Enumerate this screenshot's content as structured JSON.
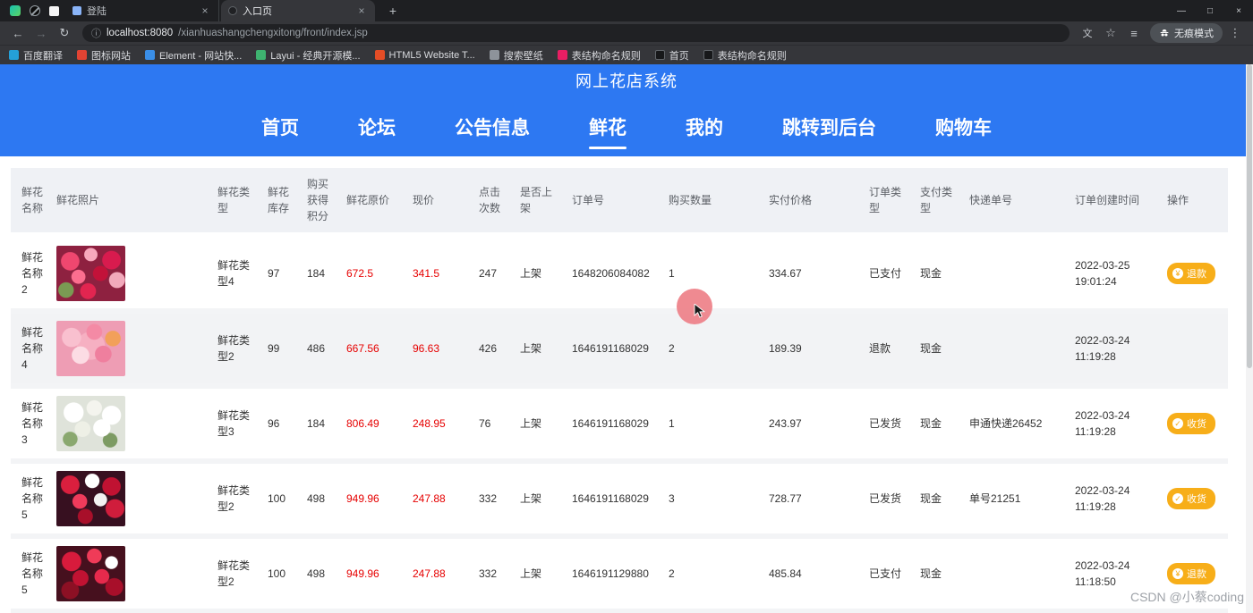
{
  "theme": {
    "header_blue": "#2d78f2",
    "price_red": "#e60000",
    "button_orange": "#f7ae19"
  },
  "icons": {
    "back": "←",
    "forward": "→",
    "reload": "↻",
    "info": "ⓘ",
    "translate": "文",
    "star": "☆",
    "menu": "≡",
    "more": "⋮",
    "minimize": "—",
    "maximize": "□",
    "close": "×",
    "tab_close": "×",
    "new_tab": "+",
    "yen": "¥",
    "check": "✓"
  },
  "browser": {
    "tabs": [
      {
        "title": "登陆"
      },
      {
        "title": "入口页"
      }
    ],
    "url_host": "localhost:8080",
    "url_path": "/xianhuashangchengxitong/front/index.jsp",
    "incognito_label": "无痕模式",
    "bookmarks": [
      {
        "label": "百度翻译"
      },
      {
        "label": "图标网站"
      },
      {
        "label": "Element - 网站快..."
      },
      {
        "label": "Layui - 经典开源模..."
      },
      {
        "label": "HTML5 Website T..."
      },
      {
        "label": "搜索壁纸"
      },
      {
        "label": "表结构命名规则"
      },
      {
        "label": "首页"
      },
      {
        "label": "表结构命名规则"
      }
    ]
  },
  "site": {
    "title": "网上花店系统",
    "nav": [
      "首页",
      "论坛",
      "公告信息",
      "鲜花",
      "我的",
      "跳转到后台",
      "购物车"
    ]
  },
  "table": {
    "headers": [
      "鲜花名称",
      "鲜花照片",
      "鲜花类型",
      "鲜花库存",
      "购买获得积分",
      "鲜花原价",
      "现价",
      "点击次数",
      "是否上架",
      "订单号",
      "购买数量",
      "实付价格",
      "订单类型",
      "支付类型",
      "快递单号",
      "订单创建时间",
      "操作"
    ],
    "rows": [
      {
        "name": "鲜花名称2",
        "type": "鲜花类型4",
        "stock": "97",
        "points": "184",
        "original_price": "672.5",
        "current_price": "341.5",
        "clicks": "247",
        "on_shelf": "上架",
        "order_no": "1648206084082",
        "quantity": "1",
        "paid_price": "334.67",
        "order_type": "已支付",
        "pay_type": "现金",
        "express_no": "",
        "created": "2022-03-25 19:01:24",
        "action": "退款"
      },
      {
        "name": "鲜花名称4",
        "type": "鲜花类型2",
        "stock": "99",
        "points": "486",
        "original_price": "667.56",
        "current_price": "96.63",
        "clicks": "426",
        "on_shelf": "上架",
        "order_no": "1646191168029",
        "quantity": "2",
        "paid_price": "189.39",
        "order_type": "退款",
        "pay_type": "现金",
        "express_no": "",
        "created": "2022-03-24 11:19:28",
        "action": ""
      },
      {
        "name": "鲜花名称3",
        "type": "鲜花类型3",
        "stock": "96",
        "points": "184",
        "original_price": "806.49",
        "current_price": "248.95",
        "clicks": "76",
        "on_shelf": "上架",
        "order_no": "1646191168029",
        "quantity": "1",
        "paid_price": "243.97",
        "order_type": "已发货",
        "pay_type": "现金",
        "express_no": "申通快递26452",
        "created": "2022-03-24 11:19:28",
        "action": "收货"
      },
      {
        "name": "鲜花名称5",
        "type": "鲜花类型2",
        "stock": "100",
        "points": "498",
        "original_price": "949.96",
        "current_price": "247.88",
        "clicks": "332",
        "on_shelf": "上架",
        "order_no": "1646191168029",
        "quantity": "3",
        "paid_price": "728.77",
        "order_type": "已发货",
        "pay_type": "现金",
        "express_no": "单号21251",
        "created": "2022-03-24 11:19:28",
        "action": "收货"
      },
      {
        "name": "鲜花名称5",
        "type": "鲜花类型2",
        "stock": "100",
        "points": "498",
        "original_price": "949.96",
        "current_price": "247.88",
        "clicks": "332",
        "on_shelf": "上架",
        "order_no": "1646191129880",
        "quantity": "2",
        "paid_price": "485.84",
        "order_type": "已支付",
        "pay_type": "现金",
        "express_no": "",
        "created": "2022-03-24 11:18:50",
        "action": "退款"
      }
    ]
  },
  "watermark": "CSDN @小蔡coding"
}
